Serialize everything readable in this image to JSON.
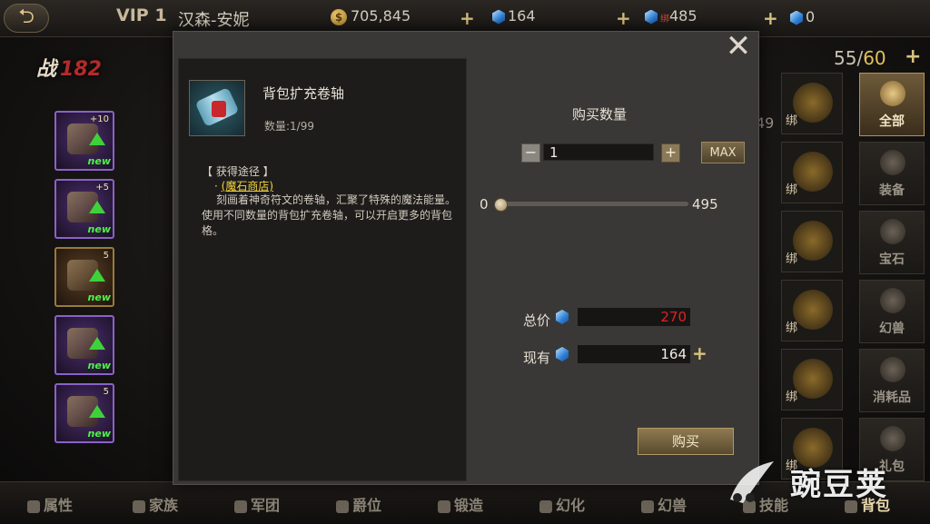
{
  "topbar": {
    "vip": "VIP 1",
    "player_name": "汉森-安妮",
    "gold": "705,845",
    "gems": "164",
    "bound_tag": "绑",
    "bound_gems": "485",
    "locked_gems": "0"
  },
  "left": {
    "combat_label": "战",
    "combat_value": "182",
    "equipment": [
      {
        "level": "+10",
        "new": "new"
      },
      {
        "level": "+5",
        "new": "new"
      },
      {
        "level": "5",
        "new": "new"
      },
      {
        "level": "",
        "new": "new"
      },
      {
        "level": "5",
        "new": "new"
      }
    ]
  },
  "inventory": {
    "used": "55",
    "slash": "/",
    "max": "60",
    "partial_count": "49",
    "bind_label": "绑",
    "categories": [
      "全部",
      "装备",
      "宝石",
      "幻兽",
      "消耗品",
      "礼包"
    ]
  },
  "bottom_nav": [
    "属性",
    "家族",
    "军团",
    "爵位",
    "锻造",
    "幻化",
    "幻兽",
    "技能",
    "背包"
  ],
  "watermark": "豌豆荚",
  "dialog": {
    "item_name": "背包扩充卷轴",
    "item_qty": "数量:1/99",
    "source_head": "【 获得途径 】",
    "source_bullet": "·",
    "source_link": "(魔石商店)",
    "description": "刻画着神奇符文的卷轴，汇聚了特殊的魔法能量。使用不同数量的背包扩充卷轴，可以开启更多的背包格。",
    "buy_title": "购买数量",
    "quantity": "1",
    "minus": "−",
    "plus": "+",
    "max_label": "MAX",
    "slider_min": "0",
    "slider_max": "495",
    "slider_fraction": 0.0,
    "total_label": "总价",
    "total_value": "270",
    "own_label": "现有",
    "own_value": "164",
    "buy_label": "购买"
  }
}
